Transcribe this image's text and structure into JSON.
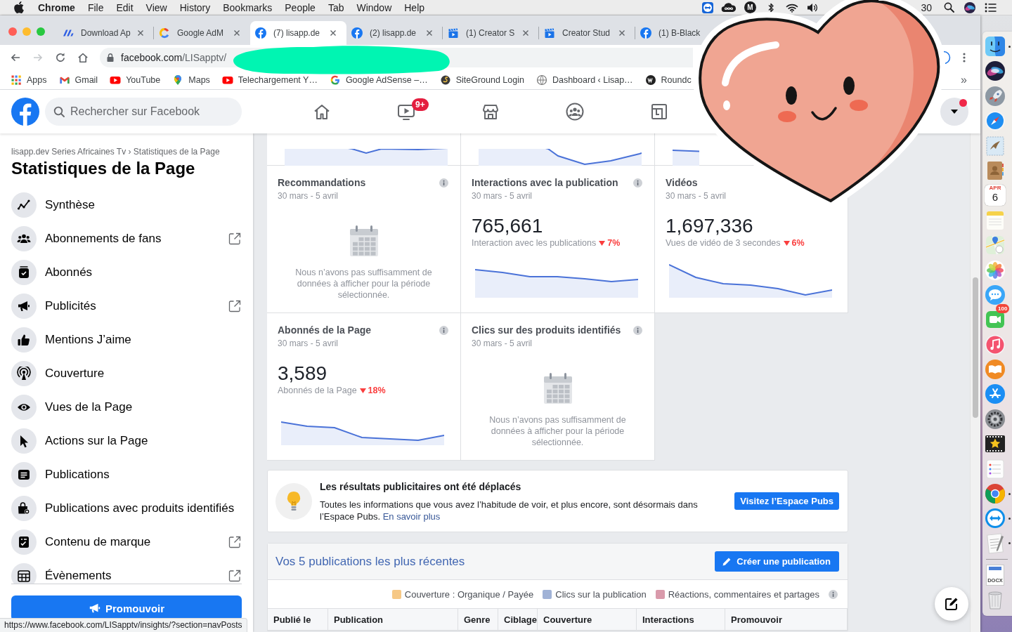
{
  "menu_bar": {
    "app": "Chrome",
    "menus": [
      "File",
      "Edit",
      "View",
      "History",
      "Bookmarks",
      "People",
      "Tab",
      "Window",
      "Help"
    ],
    "status_letter": "M",
    "clock": "30"
  },
  "browser": {
    "tabs": [
      {
        "kind": "stripes",
        "title": "Download Ap",
        "selected": false,
        "closable": true
      },
      {
        "kind": "ring",
        "title": "Google AdM",
        "selected": false,
        "closable": true
      },
      {
        "kind": "facebook",
        "title": "(7) lisapp.de",
        "selected": true,
        "closable": true
      },
      {
        "kind": "facebook",
        "title": "(2) lisapp.de",
        "selected": false,
        "closable": true
      },
      {
        "kind": "clapper",
        "title": "(1) Creator S",
        "selected": false,
        "closable": true
      },
      {
        "kind": "clapper",
        "title": "Creator Stud",
        "selected": false,
        "closable": true
      },
      {
        "kind": "facebook",
        "title": "(1) B-Black",
        "selected": false,
        "closable": false
      }
    ],
    "toolbar": [
      {
        "kind": "back",
        "disabled": false
      },
      {
        "kind": "forward",
        "disabled": true
      },
      {
        "kind": "reload",
        "disabled": false
      },
      {
        "kind": "home",
        "disabled": false
      }
    ],
    "address": {
      "host": "facebook.com",
      "path": "/LISapptv/"
    },
    "bookmarks": [
      {
        "kind": "apps",
        "label": "Apps"
      },
      {
        "kind": "mail",
        "label": "Gmail"
      },
      {
        "kind": "video",
        "label": "YouTube"
      },
      {
        "kind": "pin",
        "label": "Maps"
      },
      {
        "kind": "video",
        "label": "Telechargement Y…"
      },
      {
        "kind": "g",
        "label": "Google AdSense –…"
      },
      {
        "kind": "swirl",
        "label": "SiteGround Login"
      },
      {
        "kind": "globe",
        "label": "Dashboard ‹ Lisap…"
      },
      {
        "kind": "circle",
        "label": "Roundc"
      }
    ],
    "bookmarks_more": "»",
    "status_url": "https://www.facebook.com/LISapptv/insights/?section=navPosts"
  },
  "facebook_header": {
    "search": {
      "placeholder": "Rechercher sur Facebook"
    },
    "nav": [
      {
        "kind": "home"
      },
      {
        "kind": "video",
        "badge": "9+"
      },
      {
        "kind": "market"
      },
      {
        "kind": "groups"
      },
      {
        "kind": "gaming"
      }
    ],
    "account_alert": true
  },
  "sidebar": {
    "breadcrumb": "lisapp.dev Series Africaines Tv › Statistiques de la Page",
    "title": "Statistiques de la Page",
    "items": [
      {
        "kind": "trend",
        "label": "Synthèse",
        "external": false
      },
      {
        "kind": "people",
        "label": "Abonnements de fans",
        "external": true
      },
      {
        "kind": "inbox",
        "label": "Abonnés",
        "external": false
      },
      {
        "kind": "megaphone",
        "label": "Publicités",
        "external": true
      },
      {
        "kind": "thumb",
        "label": "Mentions J’aime",
        "external": false
      },
      {
        "kind": "broadcast",
        "label": "Couverture",
        "external": false
      },
      {
        "kind": "eye",
        "label": "Vues de la Page",
        "external": false
      },
      {
        "kind": "cursor",
        "label": "Actions sur la Page",
        "external": false
      },
      {
        "kind": "document",
        "label": "Publications",
        "external": false
      },
      {
        "kind": "bag",
        "label": "Publications avec produits identifiés",
        "external": false
      },
      {
        "kind": "checklist",
        "label": "Contenu de marque",
        "external": true
      },
      {
        "kind": "calendar",
        "label": "Évènements",
        "external": true
      }
    ],
    "promote_button": "Promouvoir"
  },
  "insights": {
    "cards": [
      {
        "kind": "cropped"
      },
      {
        "kind": "cropped"
      },
      {
        "kind": "cropped"
      },
      {
        "kind": "empty",
        "title": "Recommandations",
        "dates": "30 mars - 5 avril",
        "info": true,
        "message": "Nous n’avons pas suffisamment de données à afficher pour la période sélectionnée."
      },
      {
        "kind": "metric",
        "title": "Interactions avec la publication",
        "dates": "30 mars - 5 avril",
        "info": true,
        "value": "765,661",
        "caption": "Interaction avec les publications",
        "decrease": true,
        "change": "7%"
      },
      {
        "kind": "metric",
        "title": "Vidéos",
        "dates": "30 mars - 5 avril",
        "info": false,
        "value": "1,697,336",
        "caption": "Vues de vidéo de 3 secondes",
        "decrease": true,
        "change": "6%"
      },
      {
        "kind": "metric",
        "title": "Abonnés de la Page",
        "dates": "30 mars - 5 avril",
        "info": true,
        "value": "3,589",
        "caption": "Abonnés de la Page",
        "decrease": true,
        "change": "18%"
      },
      {
        "kind": "empty",
        "title": "Clics sur des produits identifiés",
        "dates": "30 mars - 5 avril",
        "info": true,
        "message": "Nous n’avons pas suffisamment de données à afficher pour la période sélectionnée."
      }
    ]
  },
  "notice": {
    "title": "Les résultats publicitaires ont été déplacés",
    "body": "Toutes les informations que vous avez l’habitude de voir, et plus encore, sont désormais dans l’Espace Pubs.",
    "link": "En savoir plus",
    "button": "Visitez l’Espace Pubs"
  },
  "posts": {
    "title": "Vos 5 publications les plus récentes",
    "create_button": "Créer une publication",
    "legend": [
      {
        "label": "Couverture : Organique / Payée",
        "color": "#f6c886"
      },
      {
        "label": "Clics sur la publication",
        "color": "#a0b2d6"
      },
      {
        "label": "Réactions, commentaires et partages",
        "color": "#d99aab"
      }
    ],
    "legend_info": true,
    "columns": [
      "Publié le",
      "Publication",
      "Genre",
      "Ciblage",
      "Couverture",
      "Interactions",
      "Promouvoir"
    ]
  },
  "dock": {
    "items": [
      {
        "kind": "finder",
        "running": true
      },
      {
        "kind": "siri",
        "running": false
      },
      {
        "kind": "launchpad",
        "running": false
      },
      {
        "kind": "safari",
        "running": false
      },
      {
        "kind": "mail",
        "running": false
      },
      {
        "kind": "contacts",
        "running": false
      },
      {
        "kind": "calendar",
        "running": false,
        "month": "APR",
        "day": "6"
      },
      {
        "kind": "notes",
        "running": false
      },
      {
        "kind": "maps",
        "running": false
      },
      {
        "kind": "photos",
        "running": false
      },
      {
        "kind": "messages",
        "running": false
      },
      {
        "kind": "facetime",
        "running": false,
        "badge": "100"
      },
      {
        "kind": "music",
        "running": false
      },
      {
        "kind": "books",
        "running": false
      },
      {
        "kind": "appstore",
        "running": false
      },
      {
        "kind": "settings",
        "running": false
      },
      {
        "kind": "imovie",
        "running": false
      },
      {
        "kind": "reminders",
        "running": false
      },
      {
        "kind": "chrome",
        "running": true
      },
      {
        "kind": "teamviewer",
        "running": true
      },
      {
        "kind": "textedit",
        "running": true
      },
      {
        "kind": "divider"
      },
      {
        "kind": "document",
        "running": false,
        "label": "DOCX"
      },
      {
        "kind": "trash",
        "running": false
      }
    ]
  }
}
